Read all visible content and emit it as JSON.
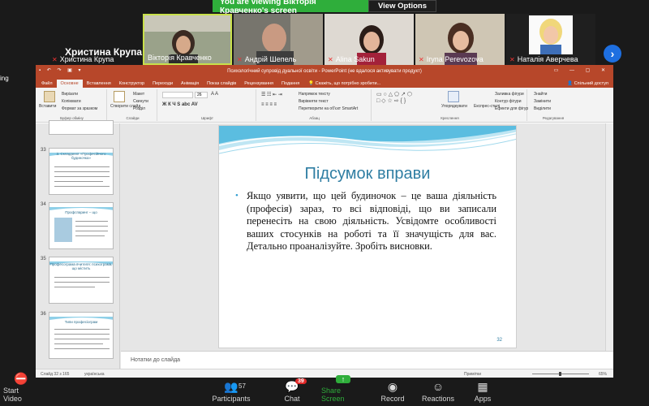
{
  "zoom_banner": {
    "text": "You are viewing Вікторія Кравченко's screen",
    "view_options": "View Options"
  },
  "gallery": {
    "active_name": "Христина Крупа",
    "participants": [
      "Христина Крупа",
      "Вікторія Кравченко",
      "Андрій Шепель",
      "Alina Sakun",
      "Iryna Perevozova",
      "Наталія Аверчева"
    ],
    "side_fragment": "ing"
  },
  "ppt": {
    "window_title": "Психологічний супровід дуальної освіти - PowerPoint (не вдалося активувати продукт)",
    "tabs": [
      "Файл",
      "Основне",
      "Вставлення",
      "Конструктор",
      "Переходи",
      "Анімація",
      "Показ слайдів",
      "Рецензування",
      "Подання"
    ],
    "tell_me": "Скажіть, що потрібно зробити...",
    "share": "Спільний доступ",
    "ribbon": {
      "clipboard": {
        "paste": "Вставити",
        "cut": "Вирізати",
        "copy": "Копіювати",
        "format": "Формат за зразком",
        "label": "Буфер обміну"
      },
      "slides": {
        "new": "Створити слайд",
        "layout": "Макет",
        "reset": "Скинути",
        "section": "Розділ",
        "label": "Слайди"
      },
      "font": {
        "size": "26",
        "label": "Шрифт"
      },
      "paragraph": {
        "direction": "Напрямок тексту",
        "align": "Вирівняти текст",
        "smartart": "Перетворити на об'єкт SmartArt",
        "label": "Абзац"
      },
      "drawing": {
        "arrange": "Упорядкувати",
        "styles": "Експрес-стилі",
        "fill": "Заливка фігури",
        "outline": "Контур фігури",
        "effects": "Ефекти для фігур",
        "label": "Креслення"
      },
      "editing": {
        "find": "Знайти",
        "replace": "Замінити",
        "select": "Виділити",
        "label": "Редагування"
      }
    },
    "thumbnails": [
      {
        "num": "33",
        "title": "3. Складання «Професійного будиночка»"
      },
      {
        "num": "34",
        "title": "Профспаринг – що"
      },
      {
        "num": "35",
        "title": "Професограма вчителя: психограма, що містить"
      },
      {
        "num": "36",
        "title": "Типи професіограм"
      }
    ],
    "slide": {
      "title": "Підсумок вправи",
      "body": "Якщо уявити, що цей будиночок – це ваша діяльність (професія) зараз, то всі відповіді, що ви записали перенесіть на свою діяльність. Усвідомте особливості ваших стосунків на роботі та її значущість для вас. Детально проаналізуйте. Зробіть висновки.",
      "number": "32"
    },
    "notes_placeholder": "Нотатки до слайда",
    "status": {
      "slide": "Слайд 32 з 165",
      "language": "українська",
      "notes": "Примітки",
      "zoom": "65%"
    }
  },
  "zoom_controls": {
    "start_video": "Start Video",
    "participants": "Participants",
    "participants_count": "57",
    "chat": "Chat",
    "chat_badge": "39",
    "share_screen": "Share Screen",
    "record": "Record",
    "reactions": "Reactions",
    "apps": "Apps"
  },
  "colors": {
    "ppt_red": "#b7472a",
    "zoom_green": "#2fae3b",
    "slide_title_blue": "#2f7ea3",
    "bullet": "#2b9bd0"
  }
}
